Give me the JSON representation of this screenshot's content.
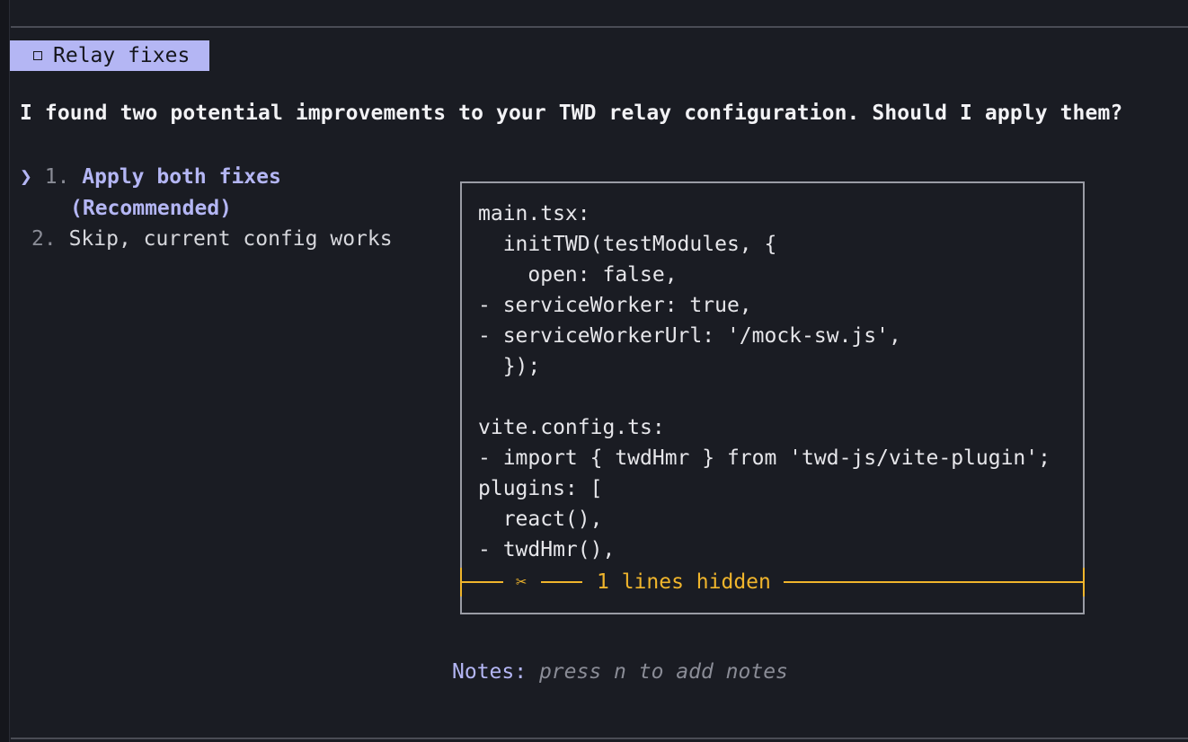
{
  "dialog": {
    "title": "Relay fixes",
    "title_icon": "checkbox-icon",
    "question": "I found two potential improvements to your TWD relay configuration. Should I apply them?"
  },
  "options": [
    {
      "cursor": "❯",
      "number": "1.",
      "label_line1": "Apply both fixes",
      "label_line2": "(Recommended)",
      "selected": true
    },
    {
      "number": "2.",
      "label": "Skip, current config works",
      "selected": false
    }
  ],
  "preview": {
    "lines": [
      "main.tsx:",
      "  initTWD(testModules, {",
      "    open: false,",
      "- serviceWorker: true,",
      "- serviceWorkerUrl: '/mock-sw.js',",
      "  });",
      "",
      "vite.config.ts:",
      "- import { twdHmr } from 'twd-js/vite-plugin';",
      "plugins: [",
      "  react(),",
      "- twdHmr(),"
    ],
    "truncation_icon": "scissors-icon",
    "truncation_text": "1 lines hidden"
  },
  "notes": {
    "label": "Notes:",
    "hint": "press n to add notes"
  },
  "colors": {
    "background": "#1a1c23",
    "accent": "#b4b6f4",
    "warning": "#f0b52c",
    "muted": "#8a8c96"
  }
}
